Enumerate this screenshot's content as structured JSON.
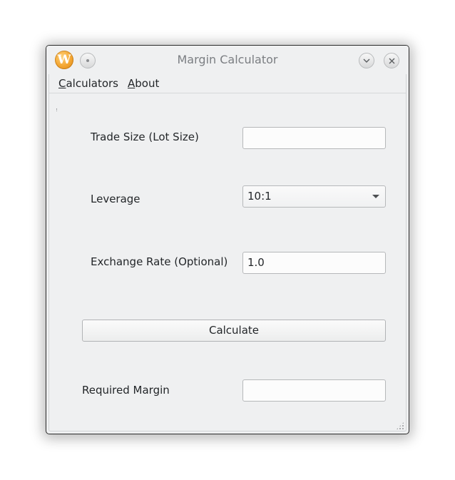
{
  "window": {
    "title": "Margin Calculator",
    "app_icon_letter": "W"
  },
  "menubar": {
    "items": [
      {
        "mnemonic": "C",
        "rest": "alculators"
      },
      {
        "mnemonic": "A",
        "rest": "bout"
      }
    ]
  },
  "form": {
    "trade_size": {
      "label": "Trade Size (Lot Size)",
      "value": ""
    },
    "leverage": {
      "label": "Leverage",
      "selected": "10:1"
    },
    "exchange_rate": {
      "label": "Exchange Rate (Optional)",
      "value": "1.0"
    },
    "calculate_button": "Calculate",
    "required_margin": {
      "label": "Required Margin",
      "value": ""
    }
  },
  "colors": {
    "window_bg": "#eff0f1",
    "text": "#232629",
    "title_text": "#7b7e82",
    "app_icon": "#f3a531"
  }
}
